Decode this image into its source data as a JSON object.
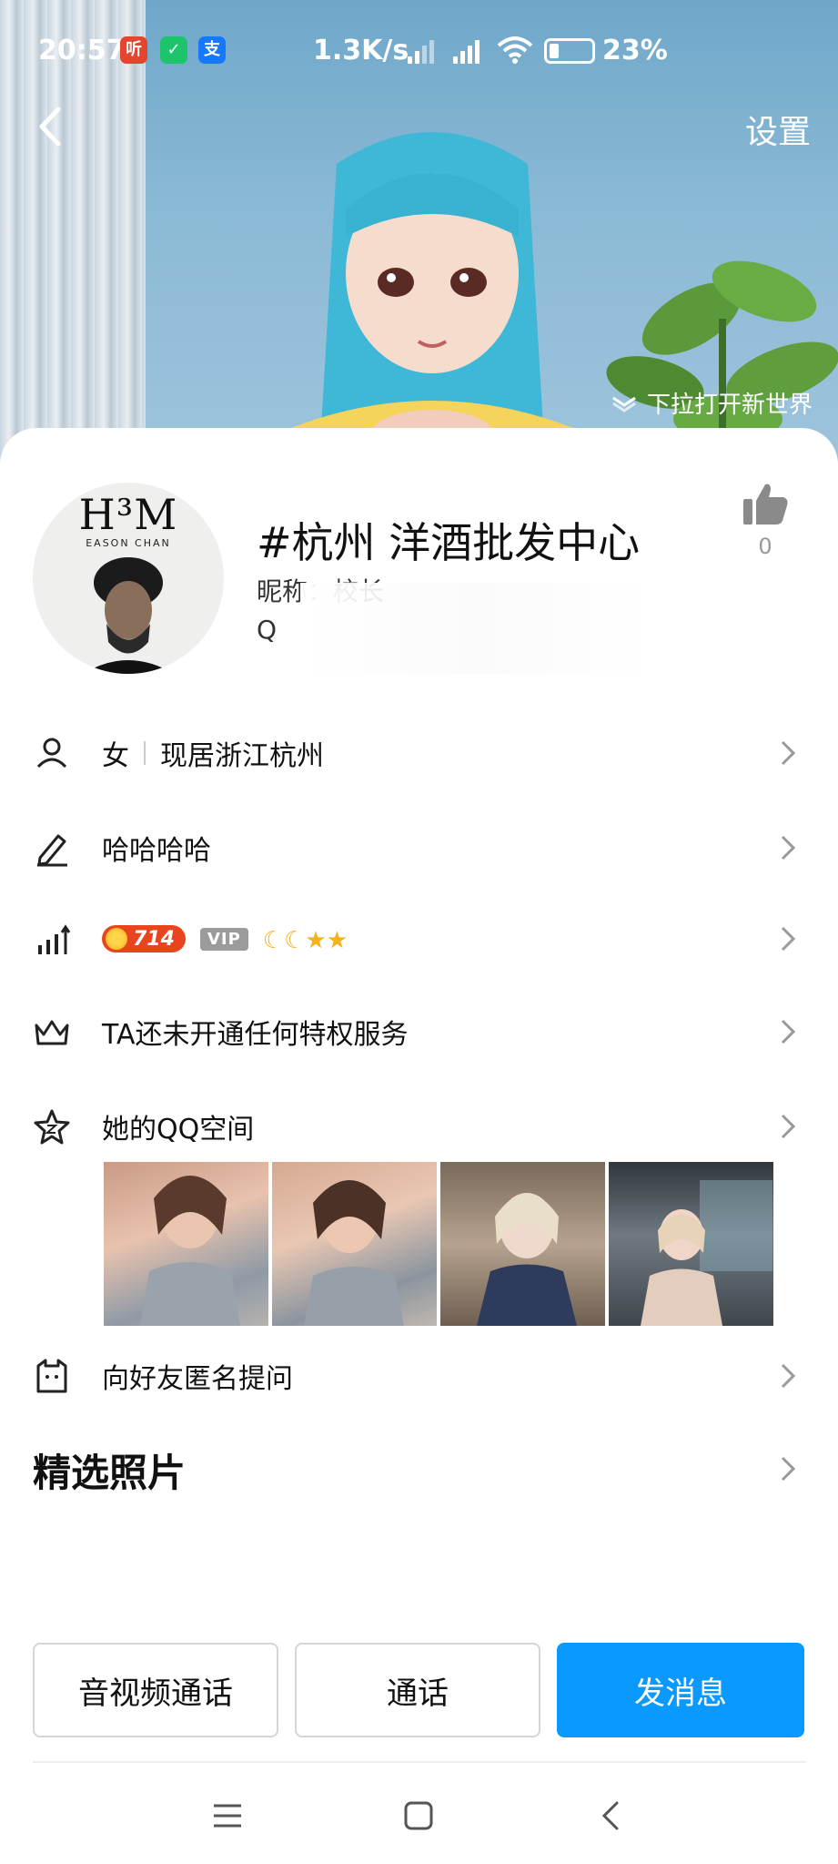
{
  "status_bar": {
    "time": "20:57",
    "app_icons": [
      {
        "name": "ting-app-icon",
        "glyph": "听",
        "color": "#e5452f"
      },
      {
        "name": "shield-app-icon",
        "glyph": "✓",
        "color": "#1ec46b"
      },
      {
        "name": "alipay-app-icon",
        "glyph": "支",
        "color": "#1677ff"
      }
    ],
    "network_speed": "1.3K/s",
    "battery_percent": "23%"
  },
  "header": {
    "settings_label": "设置",
    "pull_hint": "下拉打开新世界"
  },
  "profile": {
    "avatar_brand": "H³M",
    "avatar_sub": "EASON CHAN",
    "title": "#杭州 洋酒批发中心",
    "nickname": "昵称：校长",
    "qq_prefix": "Q",
    "like_count": "0"
  },
  "rows": {
    "gender": "女",
    "location": "现居浙江杭州",
    "signature": "哈哈哈哈",
    "level": "714",
    "vip": "VIP",
    "privilege": "TA还未开通任何特权服务",
    "qzone": "她的QQ空间",
    "anonymous": "向好友匿名提问"
  },
  "photos_section_title": "精选照片",
  "actions": {
    "call": "音视频通话",
    "middle": "通话",
    "message": "发消息"
  },
  "colors": {
    "accent": "#0a99ff",
    "level_badge": "#e8451f",
    "star": "#f4b21c"
  }
}
